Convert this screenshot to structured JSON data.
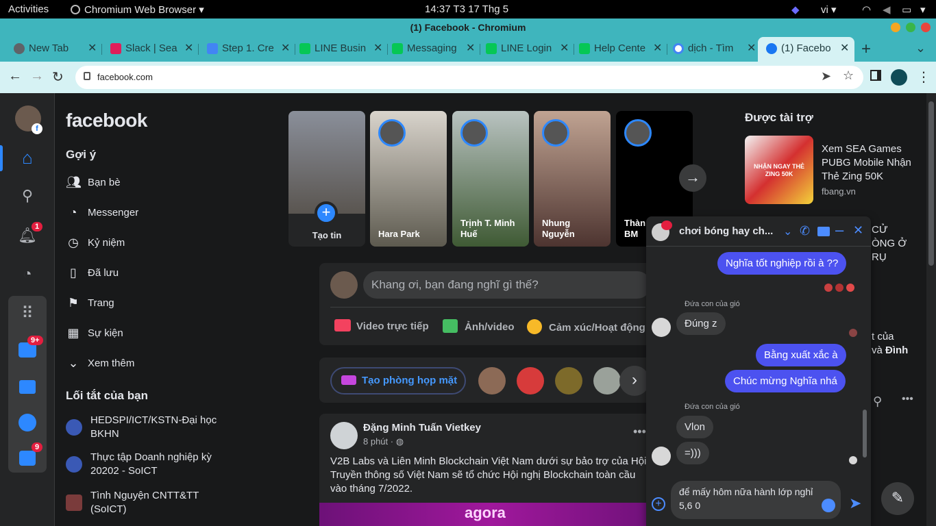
{
  "system_bar": {
    "activities": "Activities",
    "app": "Chromium Web Browser",
    "clock": "14:37  T3 17 Thg 5",
    "lang": "vi"
  },
  "window": {
    "title": "(1) Facebook - Chromium"
  },
  "tabs": [
    {
      "label": "New Tab",
      "color": "#5f6368"
    },
    {
      "label": "Slack | Sea",
      "color": "#e01e5a"
    },
    {
      "label": "Step 1. Cre",
      "color": "#4285f4"
    },
    {
      "label": "LINE Busin",
      "color": "#06c755"
    },
    {
      "label": "Messaging",
      "color": "#06c755"
    },
    {
      "label": "LINE Login",
      "color": "#06c755"
    },
    {
      "label": "Help Cente",
      "color": "#06c755"
    },
    {
      "label": "dịch - Tìm",
      "color": "#4285f4"
    },
    {
      "label": "(1) Facebo",
      "color": "#1877f2"
    }
  ],
  "address_bar": {
    "url": "facebook.com"
  },
  "fb": {
    "logo": "facebook",
    "notifications_badge": "1",
    "watch_badge": "9+",
    "gaming_badge": "9",
    "suggest_heading": "Gợi ý",
    "nav": [
      {
        "label": "Bạn bè"
      },
      {
        "label": "Messenger"
      },
      {
        "label": "Kỷ niệm"
      },
      {
        "label": "Đã lưu"
      },
      {
        "label": "Trang"
      },
      {
        "label": "Sự kiện"
      },
      {
        "label": "Xem thêm"
      }
    ],
    "shortcuts_heading": "Lối tắt của bạn",
    "shortcuts": [
      {
        "label": "HEDSPI/ICT/KSTN-Đại học BKHN"
      },
      {
        "label": "Thực tập Doanh nghiệp kỳ 20202 - SoICT"
      },
      {
        "label": "Tình Nguyện CNTT&TT (SoICT)"
      }
    ],
    "stories": [
      {
        "name": "Tạo tin"
      },
      {
        "name": "Hara Park"
      },
      {
        "name": "Trịnh T. Minh Huế"
      },
      {
        "name": "Nhung Nguyễn"
      },
      {
        "name": "Thàn BM"
      }
    ],
    "composer": {
      "placeholder": "Khang ơi, bạn đang nghĩ gì thế?",
      "live": "Video trực tiếp",
      "photo": "Ảnh/video",
      "feeling": "Cảm xúc/Hoạt động"
    },
    "room_button": "Tạo phòng họp mặt",
    "post": {
      "author": "Đặng Minh Tuấn Vietkey",
      "time": "8 phút ·",
      "text": "V2B Labs và Liên Minh Blockchain Việt Nam dưới sự bảo trợ của Hội Truyền thông số Việt Nam sẽ tổ chức Hội nghị Blockchain toàn cầu vào tháng 7/2022.",
      "banner": "agora"
    },
    "sponsored": {
      "heading": "Được tài trợ",
      "ad_title": "Xem SEA Games PUBG Mobile Nhận Thẻ Zing 50K",
      "ad_domain": "fbang.vn",
      "ad_image_text": "NHẬN NGAY THẺ ZING 50K"
    },
    "behind_chat": {
      "t1": "CỬ",
      "t2": "ÒNG Ở",
      "t3": "RỤ",
      "t4": "t của",
      "t5": "và",
      "t5b": "Đình"
    }
  },
  "chat": {
    "title": "chơi bóng hay ch...",
    "sender_name": "Đứa con của gió",
    "messages_out_1": "Nghĩa tốt nghiệp rồi à ??",
    "msg_in_1": "Đúng z",
    "messages_out_2": "Bằng xuất xắc à",
    "messages_out_3": "Chúc mừng Nghĩa nhá",
    "msg_in_2": "Vlon",
    "msg_in_3": "=)))",
    "input_text": "để mấy hôm nữa hành lớp nghỉ 5,6 0"
  }
}
